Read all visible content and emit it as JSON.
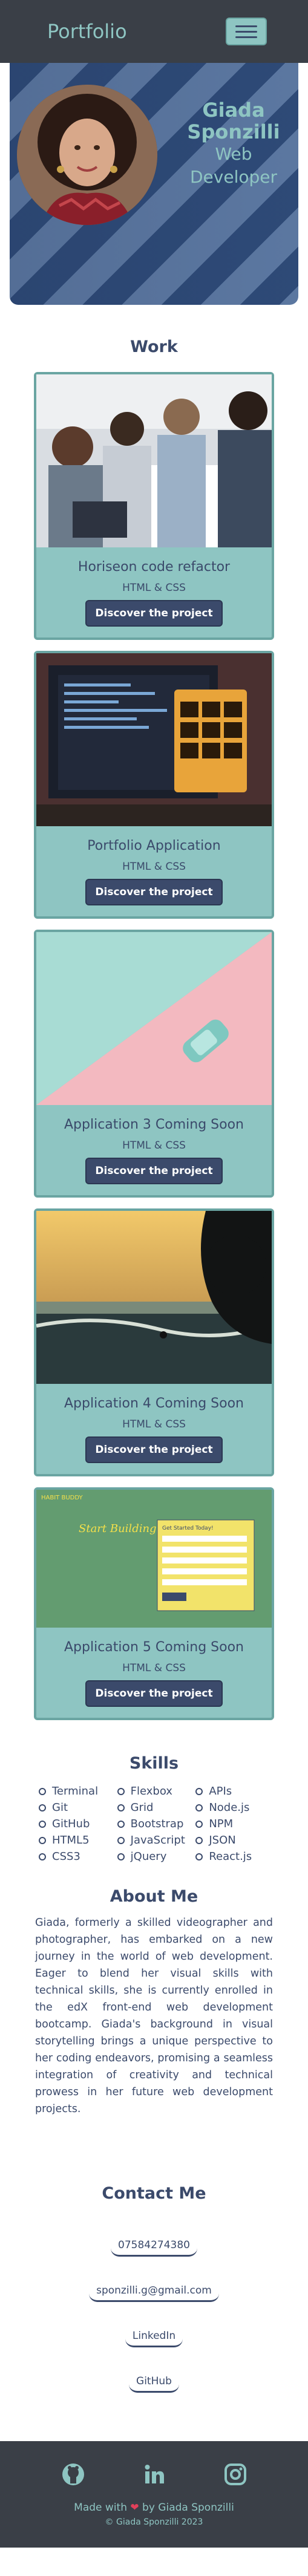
{
  "nav": {
    "logo": "Portfolio",
    "menu_icon": "hamburger-icon"
  },
  "hero": {
    "name_first": "Giada",
    "name_last": "Sponzilli",
    "role_line1": "Web",
    "role_line2": "Developer"
  },
  "work": {
    "title": "Work",
    "projects": [
      {
        "title": "Horiseon code refactor",
        "tech": "HTML & CSS",
        "button": "Discover the project"
      },
      {
        "title": "Portfolio Application",
        "tech": "HTML & CSS",
        "button": "Discover the project"
      },
      {
        "title": "Application 3 Coming Soon",
        "tech": "HTML & CSS",
        "button": "Discover the project"
      },
      {
        "title": "Application 4 Coming Soon",
        "tech": "HTML & CSS",
        "button": "Discover the project"
      },
      {
        "title": "Application 5 Coming Soon",
        "tech": "HTML & CSS",
        "button": "Discover the project"
      }
    ],
    "thumb5": {
      "heading": "Start Building Habits",
      "brand": "HABIT BUDDY",
      "form_title": "Get Started Today!"
    }
  },
  "skills": {
    "title": "Skills",
    "items": [
      "Terminal",
      "Flexbox",
      "APIs",
      "Git",
      "Grid",
      "Node.js",
      "GitHub",
      "Bootstrap",
      "NPM",
      "HTML5",
      "JavaScript",
      "JSON",
      "CSS3",
      "jQuery",
      "React.js"
    ]
  },
  "about": {
    "title": "About Me",
    "text": "Giada, formerly a skilled videographer and photographer, has embarked on a new journey in the world of web development. Eager to blend her visual skills with technical skills, she is currently enrolled in the edX front-end web development bootcamp. Giada's background in visual storytelling brings a unique perspective to her coding endeavors, promising a seamless integration of creativity and technical prowess in her future web development projects."
  },
  "contact": {
    "title": "Contact Me",
    "phone": "07584274380",
    "email": "sponzilli.g@gmail.com",
    "linkedin": "LinkedIn",
    "github": "GitHub"
  },
  "footer": {
    "made_with_prefix": "Made with",
    "made_with_suffix": "by Giada Sponzilli",
    "copyright": "© Giada Sponzilli 2023",
    "icons": [
      "github-icon",
      "linkedin-icon",
      "instagram-icon"
    ],
    "heart_color": "#e0405a"
  },
  "colors": {
    "primary": "#3b4a6b",
    "accent": "#8ec5c2",
    "dark": "#3a3f47"
  }
}
